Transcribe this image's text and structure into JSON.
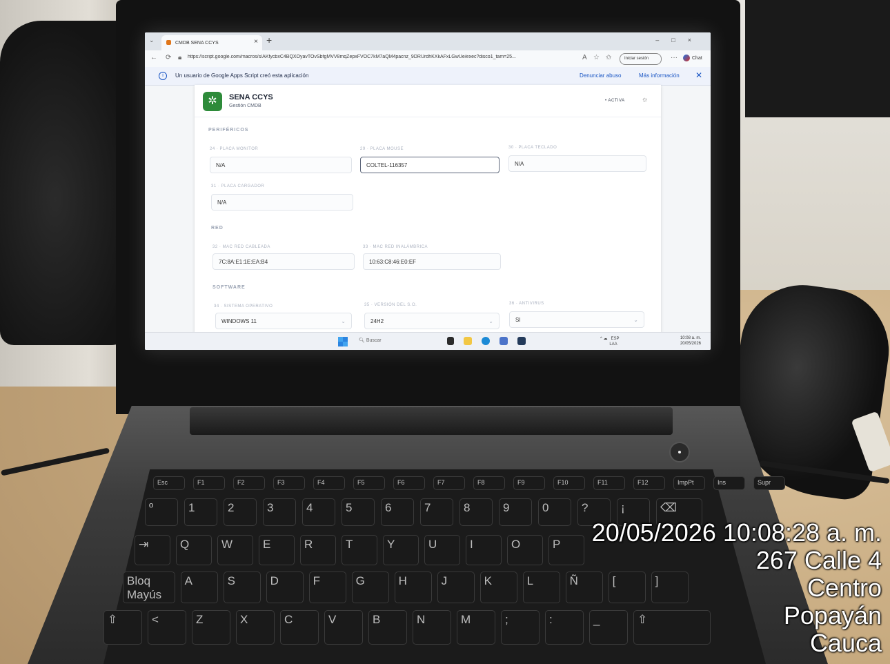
{
  "browser": {
    "tab_title": "CMDB SENA CCYS",
    "url": "https://script.google.com/macros/s/AKfycbxC4BQXOyavTOvSbfgMVV8mqZepxFVOC7kM7aQM4pacnz_9DRUrdhKXkAFxLGwUe/exec?disco1_tam=25...",
    "signin_label": "Iniciar sesión",
    "chat_label": "Chat",
    "info_message": "Un usuario de Google Apps Script creó esta aplicación",
    "report_link": "Denunciar abuso",
    "more_info_link": "Más información"
  },
  "app": {
    "title": "SENA CCYS",
    "subtitle": "Gestión CMDB",
    "status": "• ACTIVA"
  },
  "sections": {
    "perifericos": {
      "title": "PERIFÉRICOS",
      "placa_monitor": {
        "label": "24 · PLACA MONITOR",
        "value": "N/A"
      },
      "placa_mouse": {
        "label": "29 · PLACA MOUSE",
        "value": "COLTEL-116357"
      },
      "placa_teclado": {
        "label": "30 · PLACA TECLADO",
        "value": "N/A"
      },
      "placa_cargador": {
        "label": "31 · PLACA CARGADOR",
        "value": "N/A"
      }
    },
    "red": {
      "title": "RED",
      "mac_cableada": {
        "label": "32 · MAC RED CABLEADA",
        "value": "7C:8A:E1:1E:EA:B4"
      },
      "mac_inalambrica": {
        "label": "33 · MAC RED INALÁMBRICA",
        "value": "10:63:C8:46:E0:EF"
      }
    },
    "software": {
      "title": "SOFTWARE",
      "sistema_operativo": {
        "label": "34 · SISTEMA OPERATIVO",
        "value": "WINDOWS 11"
      },
      "version_so": {
        "label": "35 · VERSIÓN DEL S.O.",
        "value": "24H2"
      },
      "antivirus": {
        "label": "36 · ANTIVIRUS",
        "value": "SI"
      }
    }
  },
  "taskbar": {
    "search_placeholder": "Buscar",
    "lang": "ESP",
    "lang2": "LAA",
    "time": "10:08 a. m.",
    "date": "20/05/2026"
  },
  "keyboard": {
    "fn_row": [
      "Esc",
      "F1",
      "F2",
      "F3",
      "F4",
      "F5",
      "F6",
      "F7",
      "F8",
      "F9",
      "F10",
      "F11",
      "F12",
      "ImpPt",
      "Ins",
      "Supr"
    ],
    "row1": [
      "º",
      "1",
      "2",
      "3",
      "4",
      "5",
      "6",
      "7",
      "8",
      "9",
      "0",
      "?",
      "¡",
      "⌫"
    ],
    "row2": [
      "⇥",
      "Q",
      "W",
      "E",
      "R",
      "T",
      "Y",
      "U",
      "I",
      "O",
      "P"
    ],
    "row3": [
      "Bloq Mayús",
      "A",
      "S",
      "D",
      "F",
      "G",
      "H",
      "J",
      "K",
      "L",
      "Ñ",
      "[",
      "]"
    ],
    "row4": [
      "⇧",
      "<",
      "Z",
      "X",
      "C",
      "V",
      "B",
      "N",
      "M",
      ";",
      ":",
      "_",
      "⇧"
    ]
  },
  "overlay": {
    "datetime": "20/05/2026 10:08:28 a. m.",
    "line2": "267 Calle 4",
    "line3": "Centro",
    "line4": "Popayán",
    "line5": "Cauca"
  }
}
